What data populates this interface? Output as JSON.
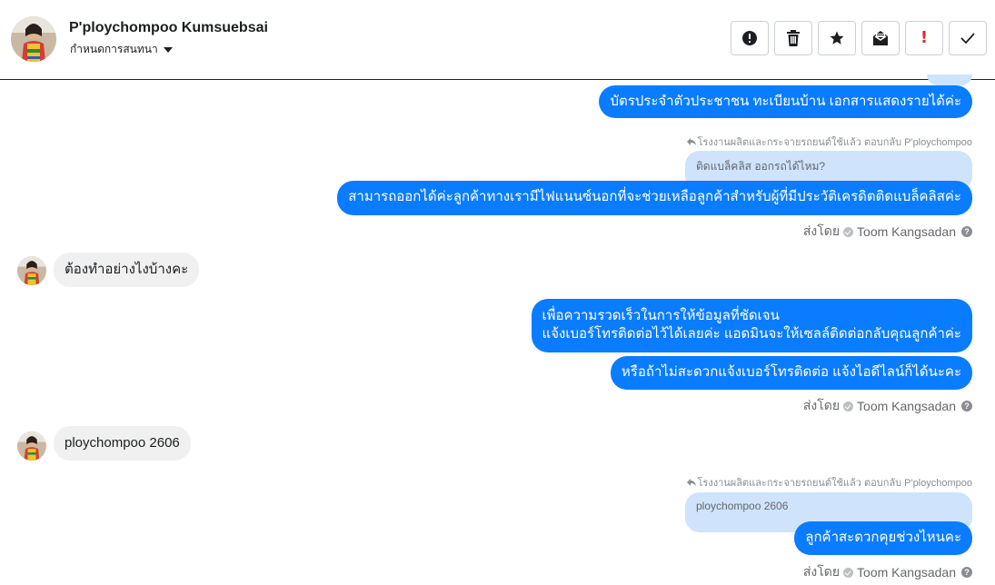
{
  "header": {
    "contact_name": "P'ploychompoo Kumsuebsai",
    "subtitle": "กำหนดการสนทนา",
    "toolbar": {
      "icons": [
        "alert-icon",
        "trash-icon",
        "star-icon",
        "mark-unread-icon",
        "important-icon",
        "done-icon"
      ],
      "important_glyph": "!"
    }
  },
  "conversation": {
    "m1_text": "บัตรประจำตัวประชาชน ทะเบียนบ้าน เอกสารแสดงรายได้ค่ะ",
    "reply1_line": "โรงงานผลิตและกระจายรถยนต์ใช้แล้ว ตอบกลับ P'ploychompoo",
    "reply1_quote": "ติดแบล็คลิส ออกรถได้ไหม?",
    "m2_text": "สามารถออกได้ค่ะลูกค้าทางเรามีไฟแนนซ์นอกที่จะช่วยเหลือลูกค้าสำหรับผู้ที่มีประวัติเครดิตติดแบล็คลิสค่ะ",
    "sent1_prefix": "ส่งโดย",
    "sent1_agent": "Toom Kangsadan",
    "in1_text": "ต้องทำอย่างไงบ้างคะ",
    "m3_line1": "เพื่อความรวดเร็วในการให้ข้อมูลที่ชัดเจน",
    "m3_line2": "แจ้งเบอร์โทรติดต่อไว้ได้เลยค่ะ แอดมินจะให้เซลล์ติดต่อกลับคุณลูกค้าค่ะ",
    "m4_text": "หรือถ้าไม่สะดวกแจ้งเบอร์โทรติดต่อ แจ้งไอดีไลน์ก็ได้นะคะ",
    "sent2_prefix": "ส่งโดย",
    "sent2_agent": "Toom Kangsadan",
    "in2_text": "ploychompoo 2606",
    "reply2_line": "โรงงานผลิตและกระจายรถยนต์ใช้แล้ว ตอบกลับ P'ploychompoo",
    "reply2_quote": "ploychompoo 2606",
    "m5_text": "ลูกค้าสะดวกคุยช่วงไหนคะ",
    "sent3_prefix": "ส่งโดย",
    "sent3_agent": "Toom Kangsadan"
  },
  "colors": {
    "outgoing_bubble": "#0a7cff",
    "incoming_bubble": "#f0f0f0",
    "quote_bubble": "#cfe3fd",
    "important_red": "#e4272c"
  }
}
